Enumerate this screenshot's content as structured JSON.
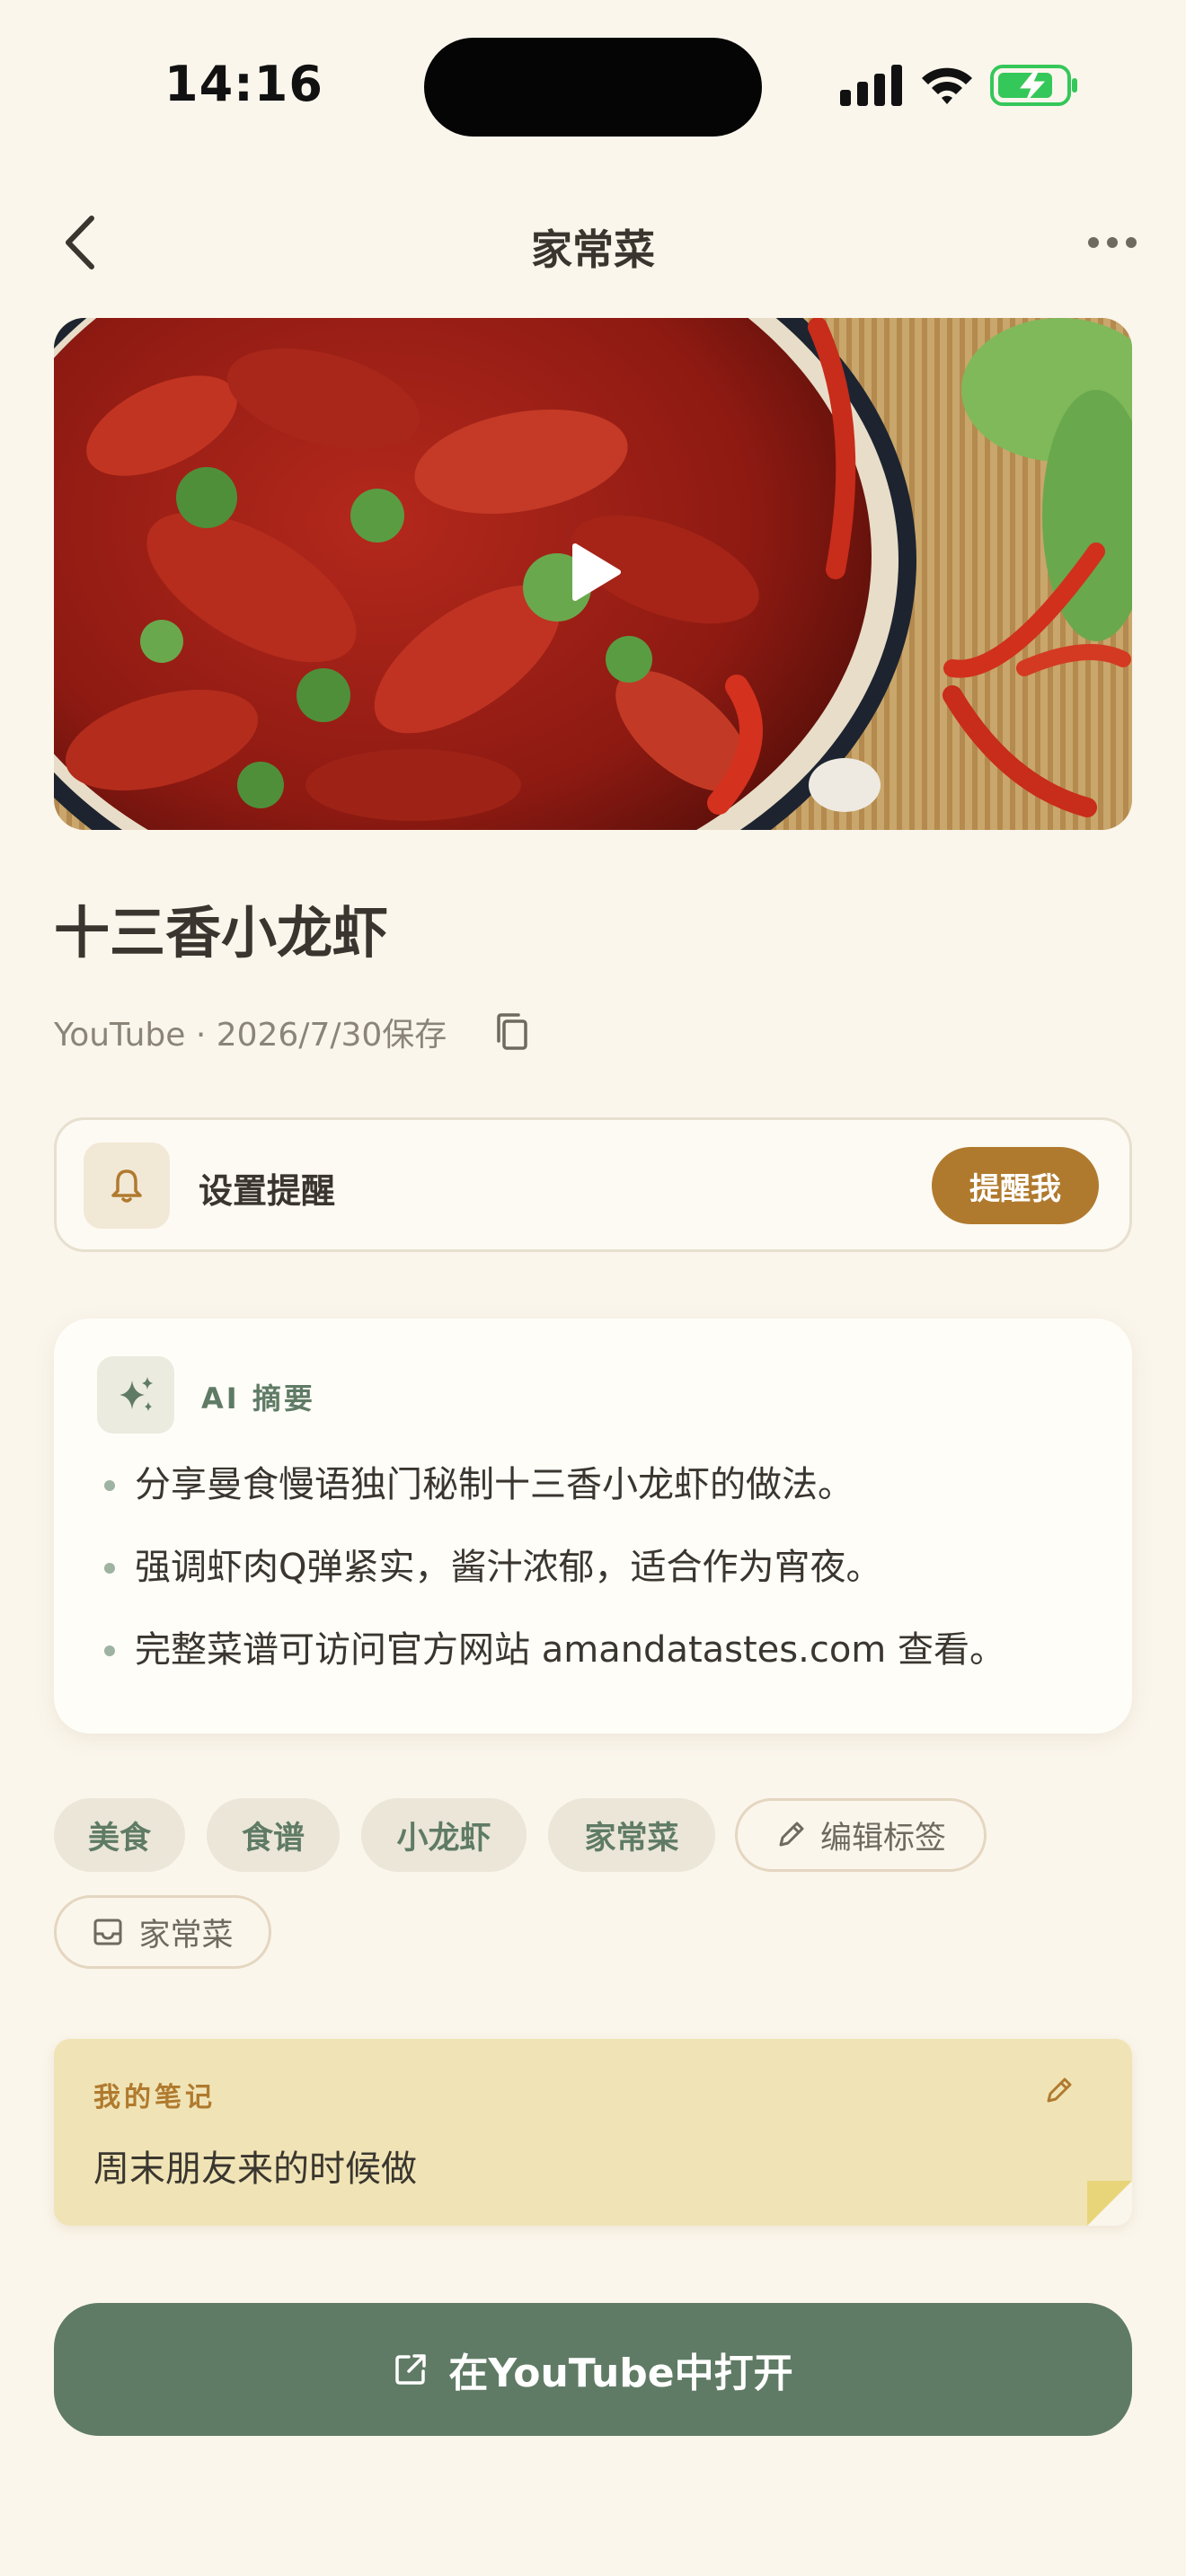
{
  "status_bar": {
    "time": "14:16"
  },
  "nav": {
    "title": "家常菜"
  },
  "recipe": {
    "title": "十三香小龙虾",
    "meta": "YouTube · 2026/7/30保存"
  },
  "reminder": {
    "label": "设置提醒",
    "button": "提醒我"
  },
  "ai_summary": {
    "title": "AI 摘要",
    "items": [
      "分享曼食慢语独门秘制十三香小龙虾的做法。",
      "强调虾肉Q弹紧实，酱汁浓郁，适合作为宵夜。",
      "完整菜谱可访问官方网站 amandatastes.com 查看。"
    ]
  },
  "tags": {
    "items": [
      "美食",
      "食谱",
      "小龙虾",
      "家常菜"
    ],
    "edit_label": "编辑标签",
    "collection": "家常菜"
  },
  "notes": {
    "label": "我的笔记",
    "text": "周末朋友来的时候做"
  },
  "open_button": {
    "label": "在YouTube中打开"
  },
  "colors": {
    "background": "#fbf6ec",
    "accent_green": "#5f7b65",
    "accent_gold": "#b07a2e",
    "note_yellow": "#f0e4b6",
    "battery_green": "#34c759"
  }
}
